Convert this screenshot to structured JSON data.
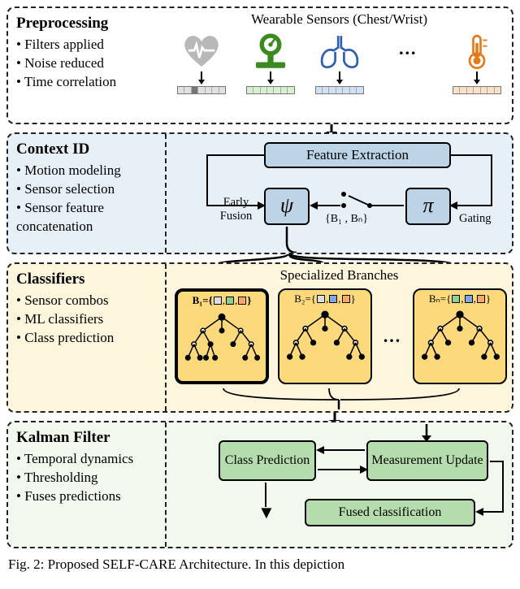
{
  "figure_caption": "Fig. 2: Proposed SELF-CARE Architecture. In this depiction",
  "preprocessing": {
    "title": "Preprocessing",
    "bullets": [
      "Filters applied",
      "Noise reduced",
      "Time correlation"
    ],
    "sensor_header": "Wearable Sensors (Chest/Wrist)",
    "dots": "…"
  },
  "context": {
    "title": "Context ID",
    "bullets": [
      "Motion modeling",
      "Sensor selection",
      "Sensor feature concatenation"
    ],
    "feature_extraction": "Feature Extraction",
    "psi": "ψ",
    "pi": "π",
    "early_fusion": "Early Fusion",
    "branch_set": "{B₁ , Bₙ}",
    "gating": "Gating"
  },
  "classifiers": {
    "title": "Classifiers",
    "bullets": [
      "Sensor combos",
      "ML classifiers",
      "Class prediction"
    ],
    "specialized": "Specialized Branches",
    "b1_prefix": "B₁={",
    "b2_prefix": "B₂={",
    "bn_prefix": "Bₙ={",
    "close": "}",
    "dots": "…"
  },
  "kalman": {
    "title": "Kalman Filter",
    "bullets": [
      "Temporal dynamics",
      "Thresholding",
      "Fuses predictions"
    ],
    "class_pred": "Class Prediction",
    "meas_update": "Measurement Update",
    "fused": "Fused classification"
  },
  "chart_data": {
    "type": "table",
    "title": "SELF-CARE Architecture pipeline (block diagram)",
    "stages": [
      {
        "name": "Preprocessing",
        "bullets": [
          "Filters applied",
          "Noise reduced",
          "Time correlation"
        ],
        "content": "Wearable Sensors (Chest/Wrist) → per-sensor feature strips",
        "sensors": [
          "heart/BVP (gray)",
          "weight-scale (green)",
          "respiration/lungs (blue)",
          "…",
          "temperature (orange)"
        ]
      },
      {
        "name": "Context ID",
        "bullets": [
          "Motion modeling",
          "Sensor selection",
          "Sensor feature concatenation"
        ],
        "blocks": {
          "Feature Extraction": "feeds ψ and π",
          "ψ": "Early Fusion — emits {B₁ , Bₙ}",
          "π": "Gating — switches among branch set {B₁ , Bₙ}"
        }
      },
      {
        "name": "Classifiers",
        "bullets": [
          "Sensor combos",
          "ML classifiers",
          "Class prediction"
        ],
        "content": "Specialized Branches B₁…Bₙ, each a decision-tree/ML classifier over a sensor subset",
        "branches": [
          {
            "id": "B₁",
            "sensors": [
              "gray",
              "green",
              "orange"
            ],
            "selected": true
          },
          {
            "id": "B₂",
            "sensors": [
              "gray",
              "blue",
              "orange"
            ],
            "selected": false
          },
          {
            "id": "Bₙ",
            "sensors": [
              "green",
              "blue",
              "orange"
            ],
            "selected": false
          }
        ]
      },
      {
        "name": "Kalman Filter",
        "bullets": [
          "Temporal dynamics",
          "Thresholding",
          "Fuses predictions"
        ],
        "blocks": [
          "Class Prediction",
          "Measurement Update",
          "Fused classification"
        ],
        "loop": "Class Prediction ↔ Measurement Update → Fused classification"
      }
    ]
  }
}
